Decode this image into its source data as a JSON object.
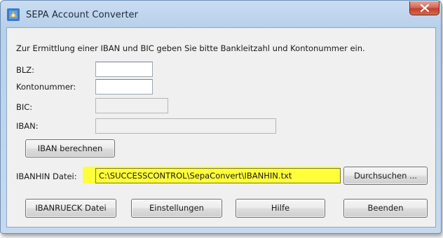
{
  "window": {
    "title": "SEPA Account Converter"
  },
  "instructions": "Zur Ermittlung einer IBAN und BIC geben Sie bitte Bankleitzahl und Kontonummer ein.",
  "fields": {
    "blz": {
      "label": "BLZ:",
      "value": ""
    },
    "kontonummer": {
      "label": "Kontonummer:",
      "value": ""
    },
    "bic": {
      "label": "BIC:",
      "value": ""
    },
    "iban": {
      "label": "IBAN:",
      "value": ""
    }
  },
  "buttons": {
    "iban_berechnen": "IBAN berechnen",
    "durchsuchen": "Durchsuchen ...",
    "ibanrueck": "IBANRUECK Datei",
    "einstellungen": "Einstellungen",
    "hilfe": "Hilfe",
    "beenden": "Beenden"
  },
  "ibanhin": {
    "label": "IBANHIN Datei:",
    "value": "C:\\SUCCESSCONTROL\\SepaConvert\\IBANHIN.txt"
  },
  "colors": {
    "highlight": "#ffff2a",
    "close_button": "#c2402b",
    "title_bar": "#c9dcf1"
  },
  "icons": {
    "app": "sepa-app-icon",
    "close": "close-icon"
  }
}
